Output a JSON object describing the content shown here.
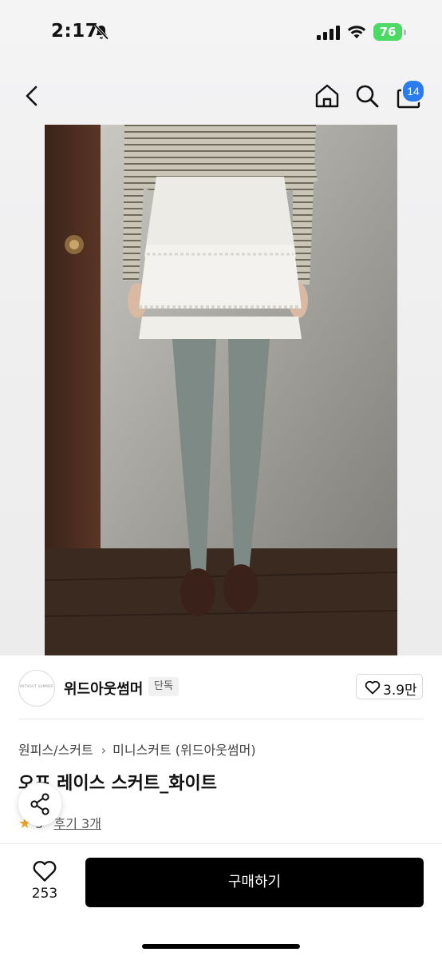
{
  "status_bar": {
    "time": "2:17",
    "battery": "76",
    "bell_icon": "bell-slash-icon",
    "signal_icon": "cellular-signal-icon",
    "wifi_icon": "wifi-icon"
  },
  "nav": {
    "back_icon": "chevron-left-icon",
    "home_icon": "home-icon",
    "search_icon": "search-icon",
    "cart_icon": "shopping-bag-icon",
    "cart_count": "14"
  },
  "seller": {
    "name": "위드아웃썸머",
    "badge": "단독",
    "likes": "3.9만"
  },
  "product": {
    "breadcrumb": [
      "원피스/스커트",
      "미니스커트 (위드아웃썸머)"
    ],
    "title": "오프 레이스 스커트_화이트",
    "rating": "5",
    "reviews": "후기 3개"
  },
  "bottom_bar": {
    "wish_count": "253",
    "buy_label": "구매하기"
  },
  "colors": {
    "badge_blue": "#2b7cf0",
    "battery_green": "#4cd964",
    "star": "#f5a623",
    "buy_button": "#000000"
  }
}
